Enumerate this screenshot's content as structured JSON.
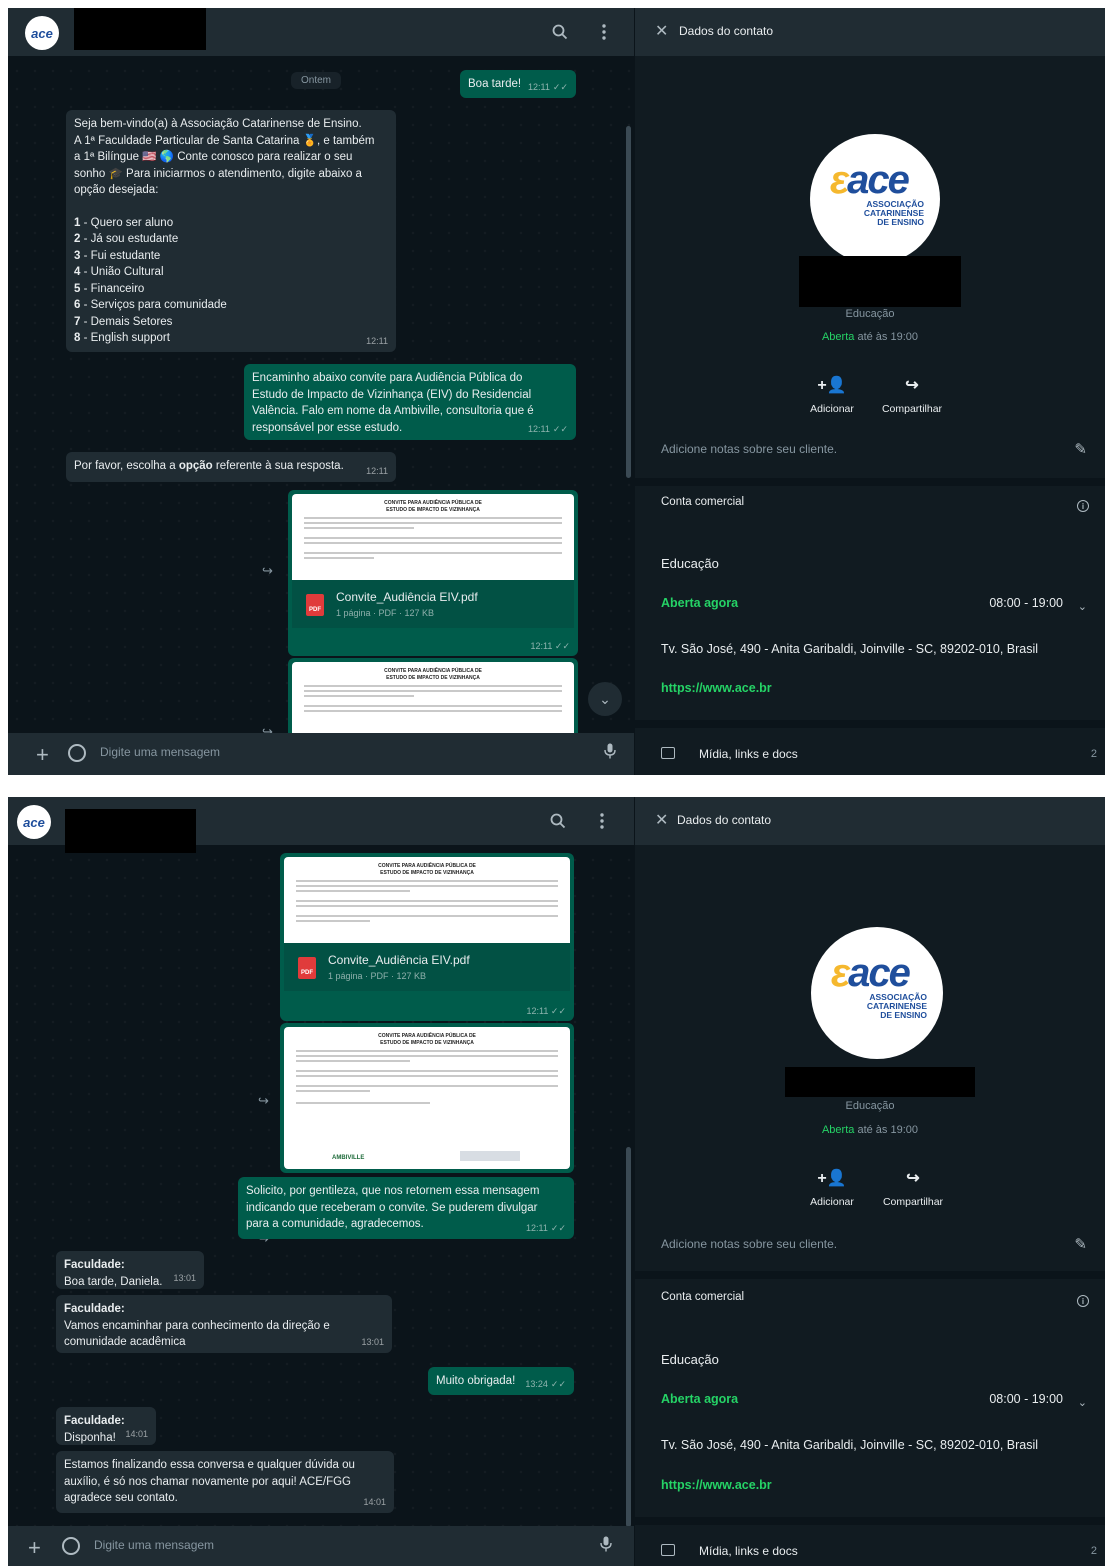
{
  "header": {
    "search_icon": "search-icon",
    "menu_icon": "menu-icon"
  },
  "composer": {
    "placeholder": "Digite uma mensagem"
  },
  "panel": {
    "title": "Dados do contato",
    "logo_text": "ace",
    "logo_sub": [
      "ASSOCIAÇÃO",
      "CATARINENSE",
      "DE ENSINO"
    ],
    "category": "Educação",
    "open_label": "Aberta",
    "open_suffix": "até às 19:00",
    "actions": {
      "add": "Adicionar",
      "share": "Compartilhar"
    },
    "notes": "Adicione notas sobre seu cliente.",
    "business": {
      "title": "Conta comercial",
      "category": "Educação",
      "open_now": "Aberta agora",
      "hours": "08:00 - 19:00",
      "address": "Tv. São José, 490 - Anita Garibaldi, Joinville - SC, 89202-010, Brasil",
      "url": "https://www.ace.br"
    },
    "media": {
      "label": "Mídia, links e docs",
      "count": "2"
    }
  },
  "screen1": {
    "day": "Ontem",
    "messages": {
      "m1": {
        "text": "Boa tarde!",
        "time": "12:11"
      },
      "m2": {
        "lines": [
          "Seja bem-vindo(a) à Associação Catarinense de Ensino.",
          "A 1ª Faculdade Particular de Santa Catarina 🏅, e também",
          "a 1ª Bilíngue 🇺🇸 🌎 Conte conosco para realizar o seu",
          "sonho 🎓 Para iniciarmos o atendimento, digite abaixo a",
          "opção desejada:"
        ],
        "options": [
          {
            "num": "1",
            "label": " - Quero ser aluno"
          },
          {
            "num": "2",
            "label": " - Já sou estudante"
          },
          {
            "num": "3",
            "label": " - Fui estudante"
          },
          {
            "num": "4",
            "label": " - União Cultural"
          },
          {
            "num": "5",
            "label": " - Financeiro"
          },
          {
            "num": "6",
            "label": " - Serviços para comunidade"
          },
          {
            "num": "7",
            "label": " - Demais Setores"
          },
          {
            "num": "8",
            "label": " - English support"
          }
        ],
        "time": "12:11"
      },
      "m3": {
        "lines": [
          "Encaminho abaixo convite para Audiência Pública do",
          "Estudo de Impacto de Vizinhança (EIV) do Residencial",
          "Valência. Falo em nome da Ambiville, consultoria que é",
          "responsável por esse estudo."
        ],
        "time": "12:11"
      },
      "m4": {
        "pre": "Por favor, escolha a ",
        "bold": "opção",
        "post": " referente à sua resposta.",
        "time": "12:11"
      }
    },
    "pdf": {
      "doc_title_1": "CONVITE PARA AUDIÊNCIA PÚBLICA DE",
      "doc_title_2": "ESTUDO DE IMPACTO DE VIZINHANÇA",
      "name": "Convite_Audiência EIV.pdf",
      "meta": "1 página · PDF · 127 KB",
      "time": "12:11",
      "badge": "PDF"
    }
  },
  "screen2": {
    "pdf": {
      "doc_title_1": "CONVITE PARA AUDIÊNCIA PÚBLICA DE",
      "doc_title_2": "ESTUDO DE IMPACTO DE VIZINHANÇA",
      "name": "Convite_Audiência EIV.pdf",
      "meta": "1 página · PDF · 127 KB",
      "time": "12:11",
      "badge": "PDF"
    },
    "image_time": "12:11",
    "image_brand": "AMBIVILLE",
    "messages": {
      "m1": {
        "lines": [
          "Solicito, por gentileza, que nos retornem essa mensagem",
          "indicando que receberam o convite. Se puderem divulgar",
          "para a comunidade, agradecemos."
        ],
        "time": "12:11"
      },
      "m2": {
        "sender": "Faculdade:",
        "text": "Boa tarde, Daniela.",
        "time": "13:01"
      },
      "m3": {
        "sender": "Faculdade:",
        "lines": [
          "Vamos encaminhar para conhecimento da direção e",
          "comunidade acadêmica"
        ],
        "time": "13:01"
      },
      "m4": {
        "text": "Muito obrigada!",
        "time": "13:24"
      },
      "m5": {
        "sender": "Faculdade:",
        "text": "Disponha!",
        "time": "14:01"
      },
      "m6": {
        "lines": [
          "Estamos finalizando essa conversa e qualquer dúvida ou",
          "auxílio, é só nos chamar novamente por aqui! ACE/FGG",
          "agradece seu contato."
        ],
        "time": "14:01"
      }
    }
  },
  "colors": {
    "accent": "#25d366",
    "outgoing": "#005c4b",
    "incoming": "#202c33",
    "background": "#0b141a",
    "panel": "#111b21"
  },
  "icons": {
    "search": "search-icon",
    "menu": "menu-icon",
    "close": "close-icon",
    "add_contact": "add-contact-icon",
    "share": "share-icon",
    "pencil": "pencil-icon",
    "info": "info-icon",
    "media": "media-icon",
    "mic": "mic-icon",
    "emoji": "emoji-icon",
    "plus": "plus-icon",
    "forward": "forward-icon",
    "chevron": "chevron-down-icon"
  }
}
